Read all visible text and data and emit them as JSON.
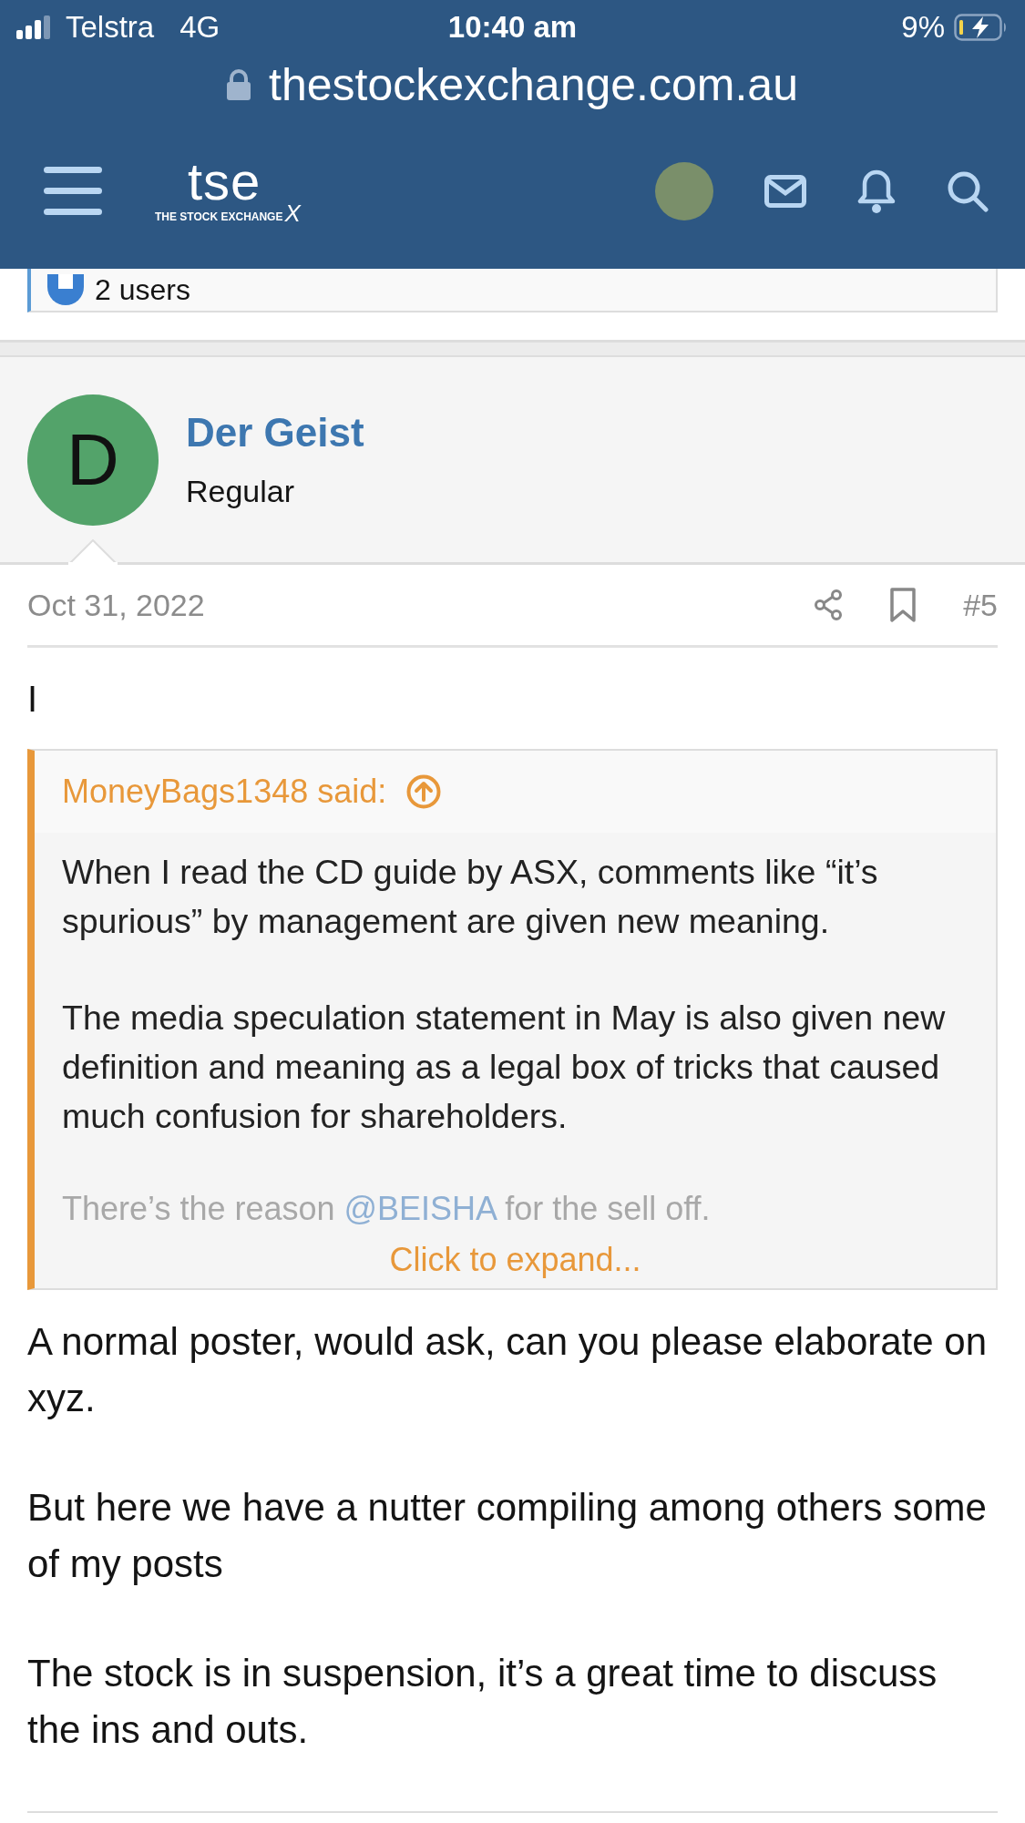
{
  "status_bar": {
    "carrier": "Telstra",
    "network": "4G",
    "time": "10:40 am",
    "battery": "9%"
  },
  "browser": {
    "url": "thestockexchange.com.au"
  },
  "site_header": {
    "logo_text": "tse",
    "logo_subtitle": "THE STOCK EXCHANGE",
    "logo_mark": "X"
  },
  "reactions": {
    "text": "2 users"
  },
  "post": {
    "author_initial": "D",
    "author": "Der Geist",
    "role": "Regular",
    "date": "Oct 31, 2022",
    "number": "#5",
    "intro": "I",
    "quote": {
      "author": "MoneyBags1348 said:",
      "paragraphs": [
        "When I read the CD guide by ASX, comments like “it’s spurious” by management are given new meaning.",
        "The media speculation statement in May is also given new definition and meaning as a legal box of tricks that caused much confusion for shareholders."
      ],
      "faded_line": {
        "before": "There’s the reason ",
        "mention": "@BEISHA",
        "after": " for the sell off."
      },
      "expand": "Click to expand..."
    },
    "paragraphs": [
      "A normal poster, would ask, can you please elaborate on xyz.",
      "But here we have a nutter compiling among others some of my posts",
      "The stock is in suspension, it’s a great time to discuss the ins and outs."
    ]
  }
}
